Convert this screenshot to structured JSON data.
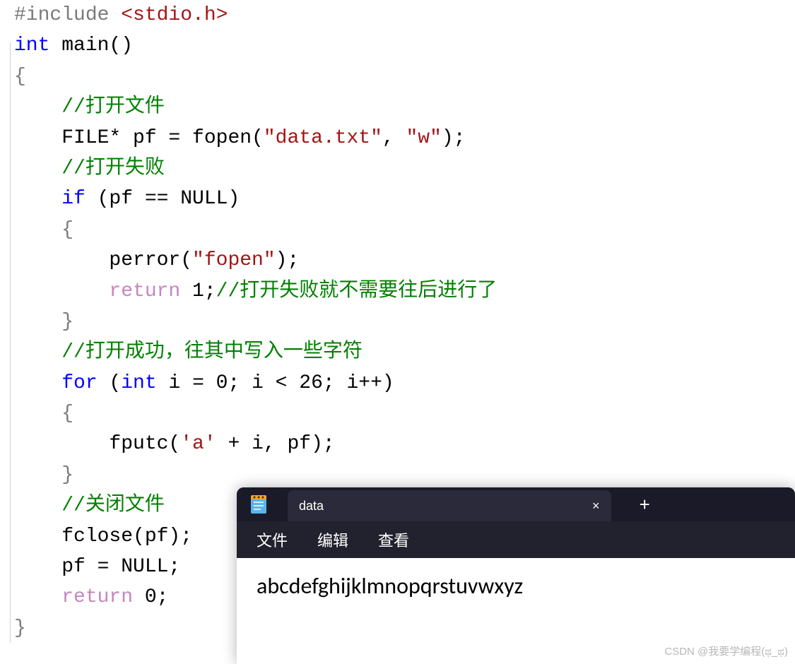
{
  "code": {
    "line1_pre": "#include",
    "line1_inc": " <stdio.h>",
    "line2_kw": "int",
    "line2_main": " main()",
    "line3": "{",
    "line4_comment": "    //打开文件",
    "line5_a": "    FILE* pf = fopen(",
    "line5_str1": "\"data.txt\"",
    "line5_b": ", ",
    "line5_str2": "\"w\"",
    "line5_c": ");",
    "line6_comment": "    //打开失败",
    "line7_kw": "    if",
    "line7_rest": " (pf == NULL)",
    "line8": "    {",
    "line9_a": "        perror(",
    "line9_str": "\"fopen\"",
    "line9_b": ");",
    "line10_kw": "        return",
    "line10_num": " 1",
    "line10_semi": ";",
    "line10_comment": "//打开失败就不需要往后进行了",
    "line11": "    }",
    "line12_comment": "    //打开成功，往其中写入一些字符",
    "line13_kw1": "    for",
    "line13_a": " (",
    "line13_kw2": "int",
    "line13_b": " i = 0; i < 26; i++)",
    "line14": "    {",
    "line15_a": "        fputc(",
    "line15_char": "'a'",
    "line15_b": " + i, pf);",
    "line16": "    }",
    "line17_comment": "    //关闭文件",
    "line18": "    fclose(pf);",
    "line19": "    pf = NULL;",
    "line20_kw": "    return",
    "line20_rest": " 0;",
    "line21": "}"
  },
  "notepad": {
    "tab_title": "data",
    "close_label": "×",
    "new_tab_label": "+",
    "menu": {
      "file": "文件",
      "edit": "编辑",
      "view": "查看"
    },
    "content": "abcdefghijklmnopqrstuvwxyz"
  },
  "watermark": "CSDN @我要学编程(ಥ_ಥ)"
}
